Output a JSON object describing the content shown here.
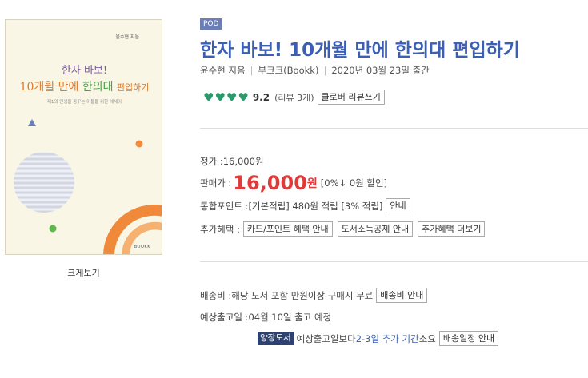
{
  "cover": {
    "author_tag": "윤수현 지음",
    "title_line1": "한자 바보!",
    "title_line2_a": "10개월",
    "title_line2_b": "만에",
    "title_line2_c": "한의대",
    "title_line2_d": "편입하기",
    "subtitle": "제1의 인생을 꿈꾸는 이들을 위한 에세이",
    "publisher": "BOOKK",
    "colors": {
      "orange": "#f08a3a",
      "green": "#5cb84a",
      "blue_triangle": "#6a7eb8",
      "gray_circle": "#dde0ea"
    }
  },
  "zoom_label": "크게보기",
  "pod_badge": "POD",
  "title": "한자 바보! 10개월 만에 한의대 편입하기",
  "meta": {
    "author": "윤수현 지음",
    "publisher": "부크크(Bookk)",
    "date": "2020년 03월 23일 출간"
  },
  "rating": {
    "score": "9.2",
    "count_text": "(리뷰 3개)",
    "review_button": "클로버 리뷰쓰기",
    "hearts": 4,
    "heart_icon": "heart-icon",
    "color": "#2a9a6a"
  },
  "price": {
    "list_label": "정가 : ",
    "list_value": "16,000원",
    "sale_label": "판매가 : ",
    "sale_value": "16,000",
    "sale_unit": "원",
    "discount": "[0%↓ 0원 할인]",
    "points_label": "통합포인트 : ",
    "points_text": "[기본적립] 480원 적립 [3% 적립]",
    "points_button": "안내",
    "benefit_label": "추가혜택 : ",
    "benefit_buttons": [
      "카드/포인트 혜택 안내",
      "도서소득공제 안내",
      "추가혜택 더보기"
    ]
  },
  "delivery": {
    "fee_label": "배송비 : ",
    "fee_text": "해당 도서 포함 만원이상 구매시 무료",
    "fee_button": "배송비 안내",
    "expected_label": "예상출고일 : ",
    "expected_text": "04월 10일 출고 예정",
    "tag": "양장도서",
    "note_prefix": "예상출고일보다 ",
    "note_highlight": "2-3일 추가 기간",
    "note_suffix": "소요",
    "schedule_button": "배송일정 안내"
  },
  "accent_color": "#3a5fb5",
  "price_color": "#e03a3a"
}
